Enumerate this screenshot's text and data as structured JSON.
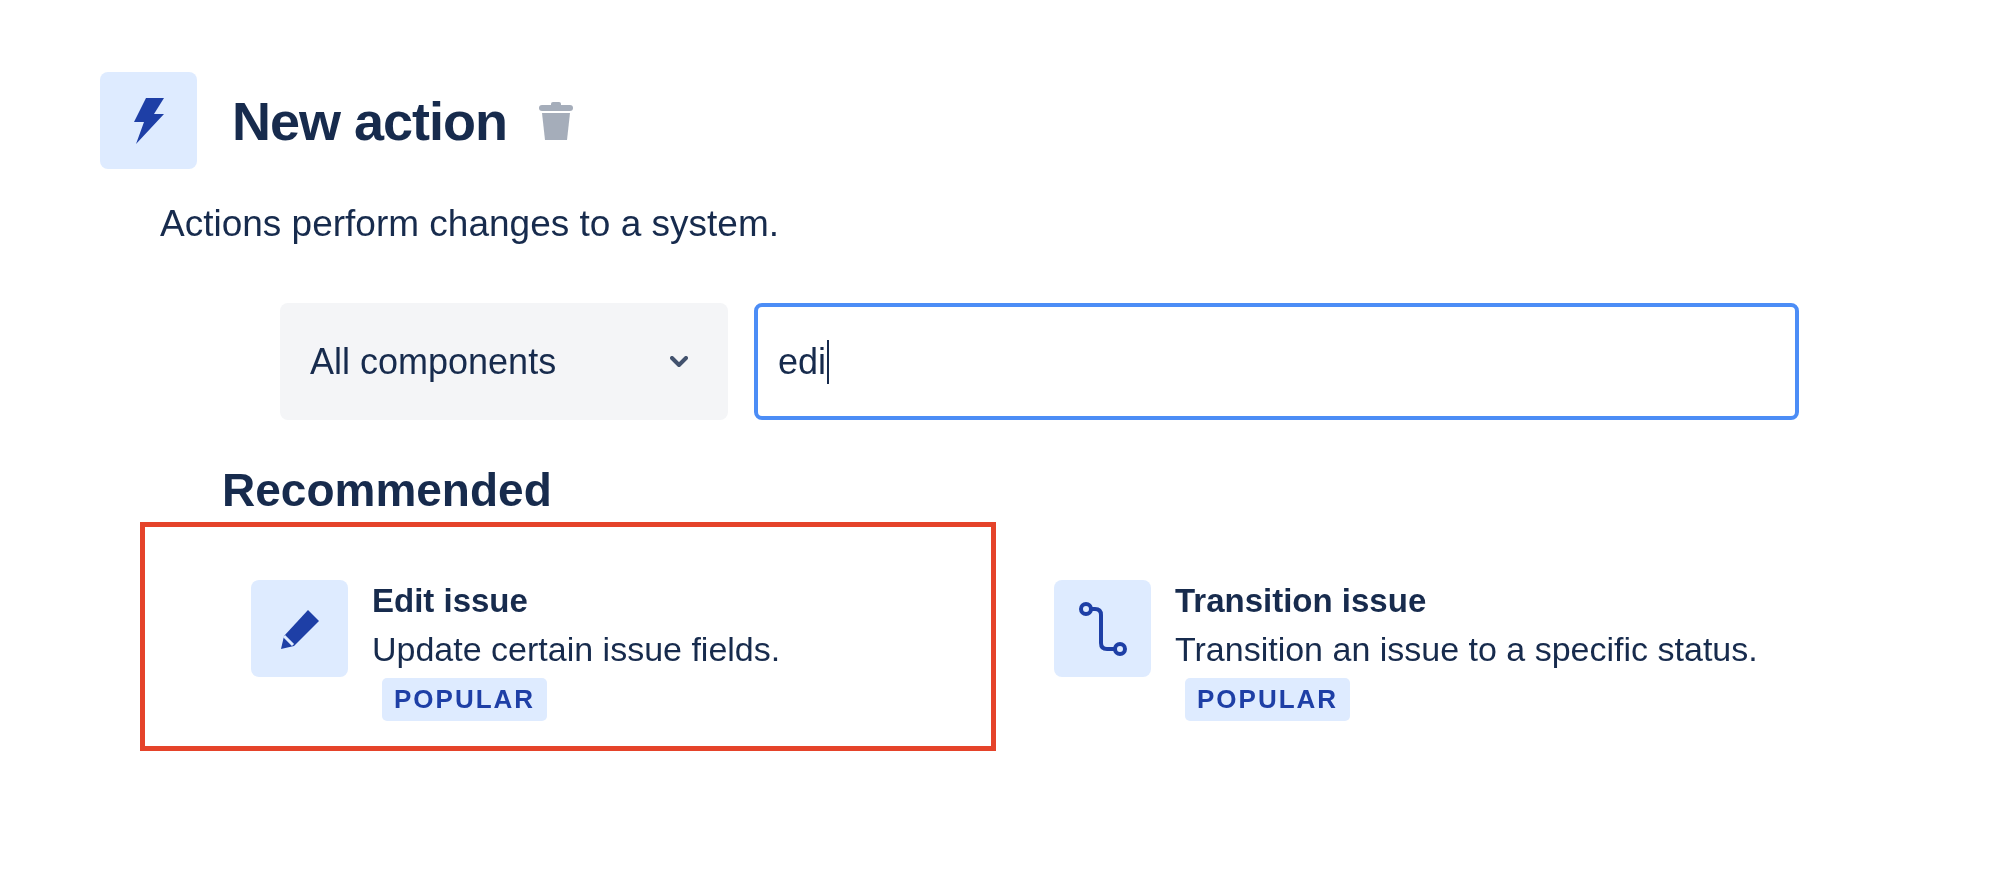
{
  "header": {
    "title": "New action",
    "description": "Actions perform changes to a system."
  },
  "filter": {
    "component_select": "All components",
    "search_value": "edi",
    "search_focused": true
  },
  "section": {
    "heading": "Recommended"
  },
  "actions": [
    {
      "title": "Edit issue",
      "description": "Update certain issue fields.",
      "badge": "POPULAR",
      "kind": "edit",
      "highlighted": true
    },
    {
      "title": "Transition issue",
      "description": "Transition an issue to a specific status.",
      "badge": "POPULAR",
      "kind": "transition",
      "highlighted": false
    }
  ]
}
